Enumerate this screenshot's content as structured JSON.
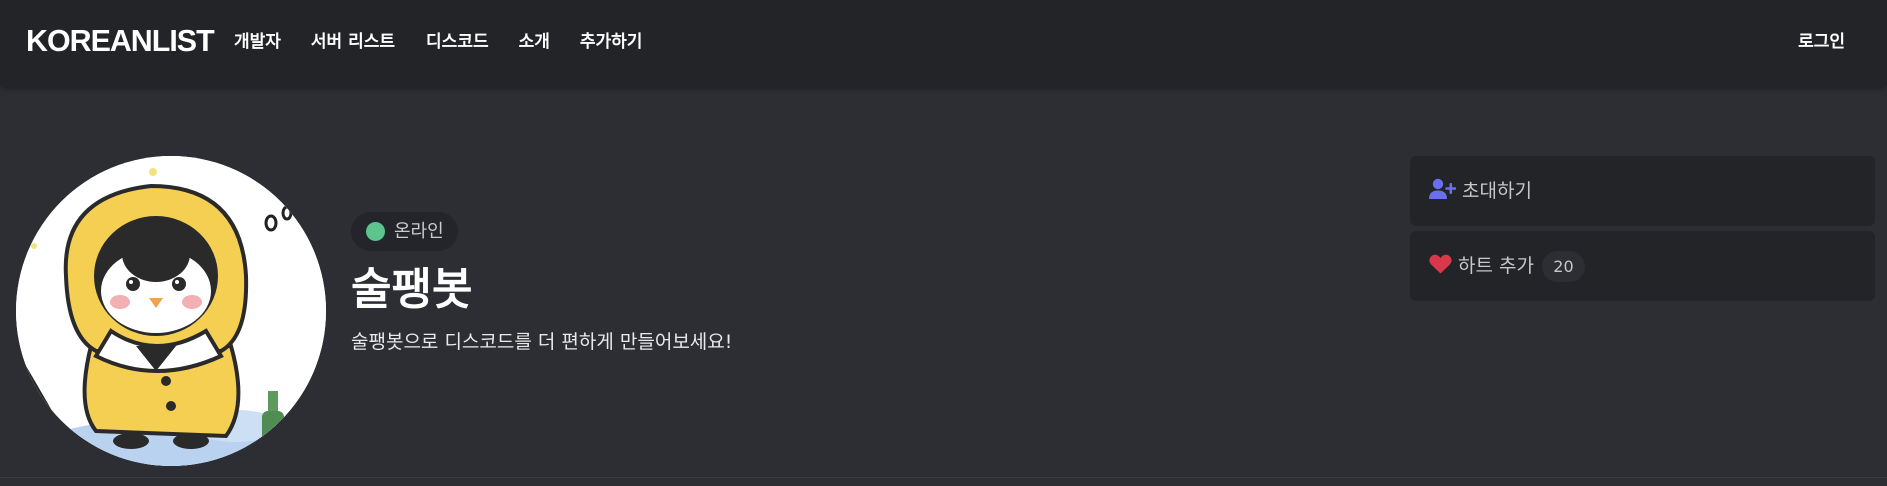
{
  "navbar": {
    "brand": "KOREANLIST",
    "links": [
      {
        "label": "개발자"
      },
      {
        "label": "서버 리스트"
      },
      {
        "label": "디스코드"
      },
      {
        "label": "소개"
      },
      {
        "label": "추가하기"
      }
    ],
    "login": "로그인"
  },
  "bot": {
    "status": "온라인",
    "status_color": "#5cc48c",
    "name": "술팽봇",
    "description": "술팽봇으로 디스코드를 더 편하게 만들어보세요!",
    "avatar_icon": "penguin-in-yellow-raincoat-avatar"
  },
  "actions": {
    "invite": {
      "label": "초대하기",
      "icon": "user-plus-icon",
      "icon_color": "#6a6ff0"
    },
    "heart": {
      "label": "하트 추가",
      "icon": "heart-icon",
      "icon_color": "#d9384a",
      "count": "20"
    }
  },
  "colors": {
    "page_background": "#2c2e33",
    "navbar_background": "#222428",
    "card_background": "#222428"
  }
}
